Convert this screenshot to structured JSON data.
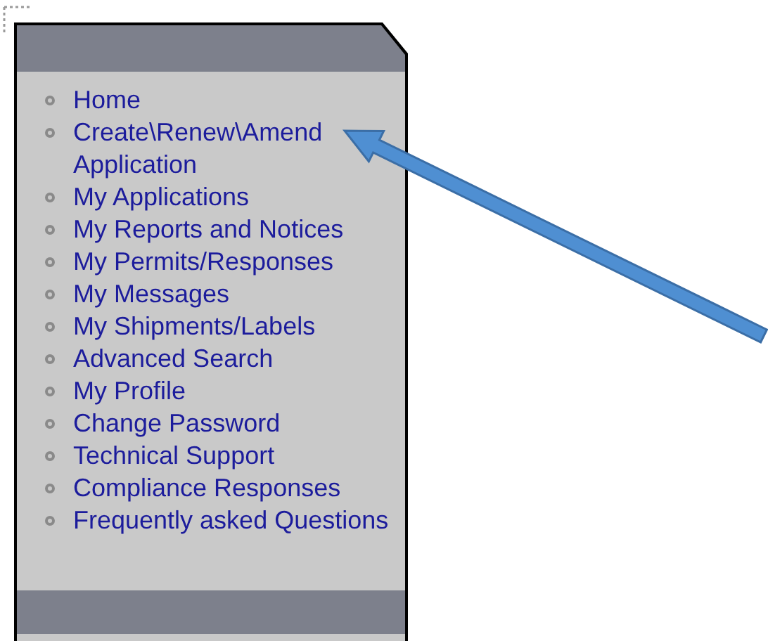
{
  "menu": {
    "items": [
      {
        "label": "Home"
      },
      {
        "label": "Create\\Renew\\Amend Application"
      },
      {
        "label": "My Applications"
      },
      {
        "label": "My Reports and Notices"
      },
      {
        "label": "My Permits/Responses"
      },
      {
        "label": "My Messages"
      },
      {
        "label": "My Shipments/Labels"
      },
      {
        "label": "Advanced Search"
      },
      {
        "label": "My Profile"
      },
      {
        "label": "Change Password"
      },
      {
        "label": "Technical Support"
      },
      {
        "label": "Compliance Responses"
      },
      {
        "label": "Frequently asked Questions"
      }
    ]
  }
}
